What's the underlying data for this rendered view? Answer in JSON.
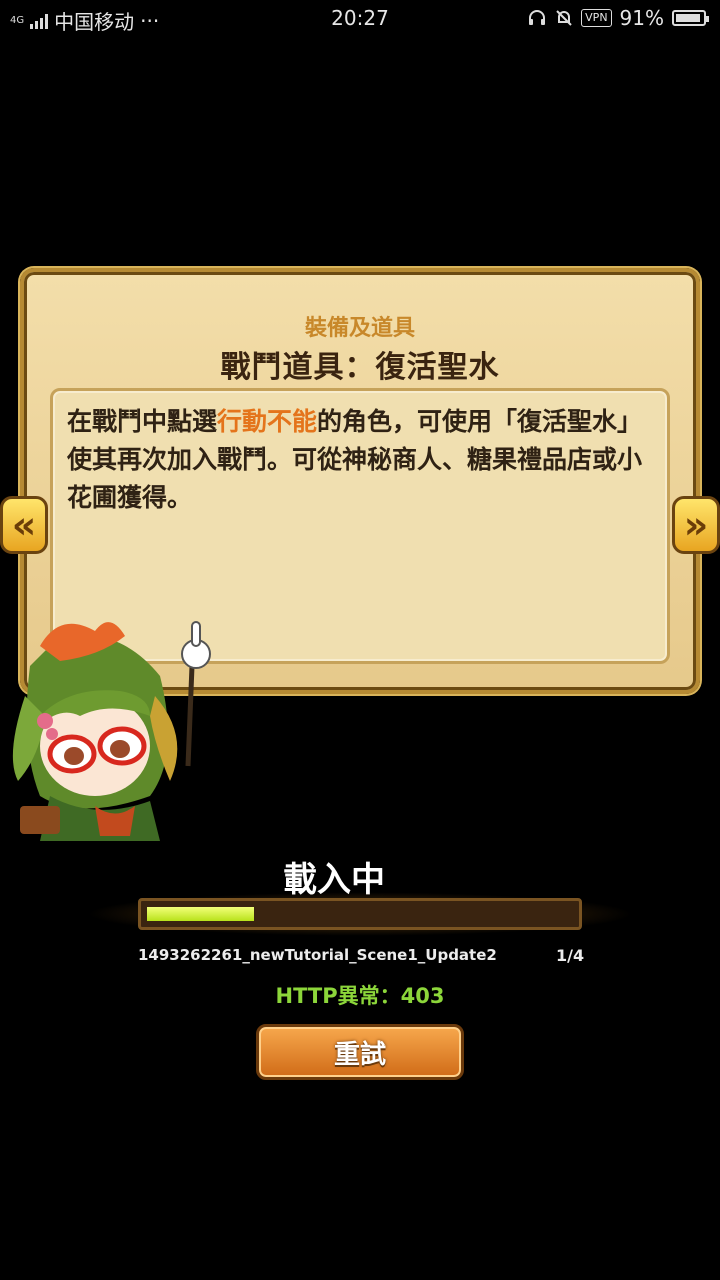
{
  "status_bar": {
    "network": "4G",
    "carrier": "中国移动",
    "more": "···",
    "time": "20:27",
    "vpn": "VPN",
    "battery": "91%",
    "battery_level": 0.91
  },
  "card": {
    "category": "裝備及道具",
    "title": "戰鬥道具：復活聖水",
    "body_pre": "在戰鬥中點選",
    "body_highlight": "行動不能",
    "body_post": "的角色，可使用「復活聖水」使其再次加入戰鬥。可從神秘商人、糖果禮品店或小花圃獲得。"
  },
  "nav": {
    "prev_glyph": "«",
    "next_glyph": "»"
  },
  "loading": {
    "label": "載入中",
    "progress": 0.25,
    "file": "1493262261_newTutorial_Scene1_Update2",
    "count": "1/4",
    "error": "HTTP異常：403",
    "retry_label": "重試"
  },
  "colors": {
    "highlight": "#e4741b",
    "error": "#8cd63a",
    "progress": "#c8ec2a"
  }
}
